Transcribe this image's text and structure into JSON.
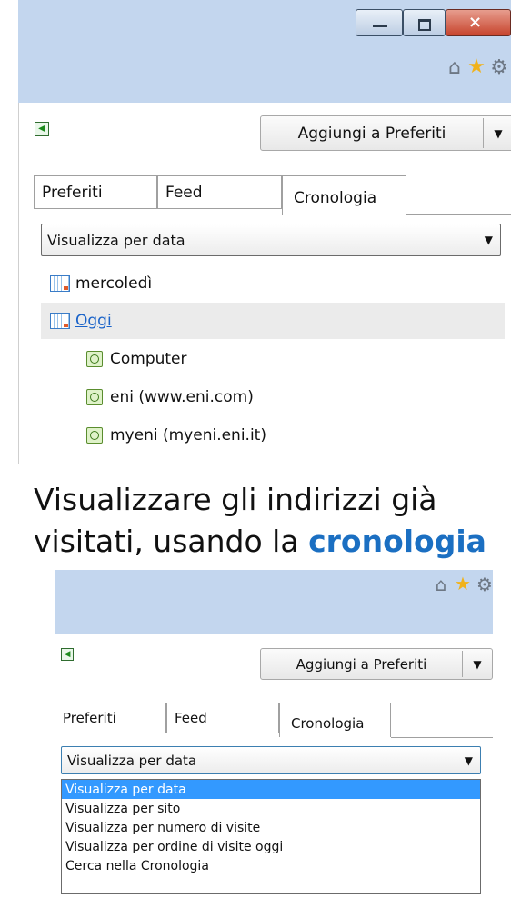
{
  "top": {
    "toolbar": {
      "icons": [
        "home-icon",
        "star-icon",
        "gear-icon"
      ]
    },
    "fav_button": {
      "label": "Aggiungi a Preferiti"
    },
    "tabs": [
      {
        "label": "Preferiti"
      },
      {
        "label": "Feed"
      },
      {
        "label": "Cronologia",
        "active": true
      }
    ],
    "view_select": {
      "value": "Visualizza per data"
    },
    "tree": [
      {
        "label": "mercoledì",
        "type": "day"
      },
      {
        "label": "Oggi",
        "type": "day",
        "selected": true
      },
      {
        "label": "Computer",
        "type": "site"
      },
      {
        "label": "eni (www.eni.com)",
        "type": "site"
      },
      {
        "label": "myeni (myeni.eni.it)",
        "type": "site"
      }
    ]
  },
  "caption": {
    "line1": "Visualizzare gli indirizzi già",
    "line2_prefix": "visitati, usando la ",
    "line2_highlight": "cronologia"
  },
  "bottom": {
    "fav_button": {
      "label": "Aggiungi a Preferiti"
    },
    "tabs": [
      {
        "label": "Preferiti"
      },
      {
        "label": "Feed"
      },
      {
        "label": "Cronologia",
        "active": true
      }
    ],
    "view_select": {
      "value": "Visualizza per data"
    },
    "dropdown_options": [
      "Visualizza per data",
      "Visualizza per sito",
      "Visualizza per numero di visite",
      "Visualizza per ordine di visite oggi",
      "Cerca nella Cronologia"
    ],
    "selected_option_index": 0
  },
  "colors": {
    "accent": "#1b6fc2",
    "link": "#1a63c9",
    "selection": "#3399ff",
    "titlebar": "#c3d6ee",
    "row_highlight": "#ebebeb"
  }
}
